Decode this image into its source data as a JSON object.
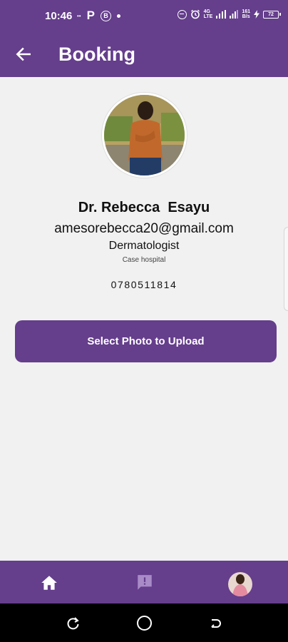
{
  "status_bar": {
    "time": "10:46",
    "left_icons": [
      "dots-icon",
      "p-icon",
      "b-circle-icon",
      "dot-icon"
    ],
    "dots_glyph": "••",
    "p_glyph": "P",
    "b_glyph": "B",
    "network_top": "4G",
    "network_bottom": "LTE",
    "speed_top": "161",
    "speed_bottom": "B/s",
    "battery": "72"
  },
  "app_bar": {
    "title": "Booking",
    "back_icon": "arrow-left-icon"
  },
  "doctor": {
    "name": "Dr. Rebecca  Esayu",
    "email": "amesorebecca20@gmail.com",
    "specialty": "Dermatologist",
    "hospital": "Case hospital",
    "phone": "0780511814"
  },
  "actions": {
    "upload_label": "Select Photo to Upload"
  },
  "bottom_nav": {
    "items": [
      "home-icon",
      "feedback-icon",
      "profile-avatar"
    ]
  },
  "colors": {
    "primary": "#653e8c",
    "background": "#f1f1f1",
    "text": "#111111"
  }
}
